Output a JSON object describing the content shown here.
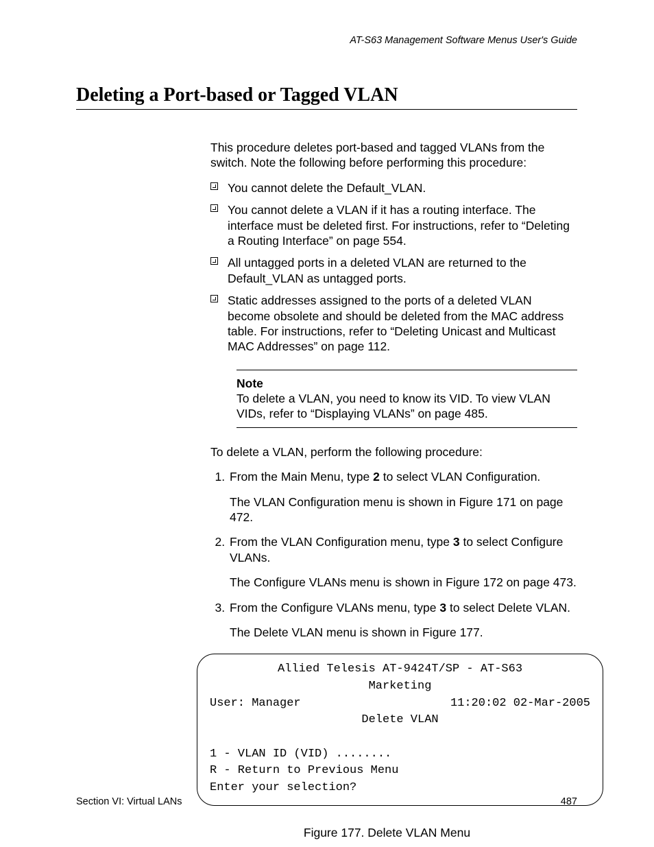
{
  "header": {
    "guide_title": "AT-S63 Management Software Menus User's Guide"
  },
  "title": "Deleting a Port-based or Tagged VLAN",
  "intro": "This procedure deletes port-based and tagged VLANs from the switch. Note the following before performing this procedure:",
  "bullets": [
    "You cannot delete the Default_VLAN.",
    "You cannot delete a VLAN if it has a routing interface. The interface must be deleted first. For instructions, refer to “Deleting a Routing Interface” on page 554.",
    "All untagged ports in a deleted VLAN are returned to the Default_VLAN as untagged ports.",
    "Static addresses assigned to the ports of a deleted VLAN become obsolete and should be deleted from the MAC address table. For instructions, refer to “Deleting Unicast and Multicast MAC Addresses” on page 112."
  ],
  "note": {
    "label": "Note",
    "text": "To delete a VLAN, you need to know its VID. To view VLAN VIDs, refer to “Displaying VLANs” on page 485."
  },
  "steps_intro": "To delete a VLAN, perform the following procedure:",
  "steps": [
    {
      "pre": "From the Main Menu, type ",
      "bold": "2",
      "post": " to select VLAN Configuration.",
      "sub": "The VLAN Configuration menu is shown in Figure 171 on page 472."
    },
    {
      "pre": "From the VLAN Configuration menu, type ",
      "bold": "3",
      "post": " to select Configure VLANs.",
      "sub": "The Configure VLANs menu is shown in Figure 172 on page 473."
    },
    {
      "pre": "From the Configure VLANs menu, type ",
      "bold": "3",
      "post": " to select Delete VLAN.",
      "sub": "The Delete VLAN menu is shown in Figure 177."
    }
  ],
  "terminal": {
    "line1": "Allied Telesis AT-9424T/SP - AT-S63",
    "line2": "Marketing",
    "user": "User: Manager",
    "time": "11:20:02 02-Mar-2005",
    "menu_title": "Delete VLAN",
    "opt1": "1 - VLAN ID (VID) ........",
    "opt2": "R - Return to Previous Menu",
    "prompt": "Enter your selection?"
  },
  "figure_caption": "Figure 177. Delete VLAN Menu",
  "footer": {
    "section": "Section VI: Virtual LANs",
    "page": "487"
  }
}
